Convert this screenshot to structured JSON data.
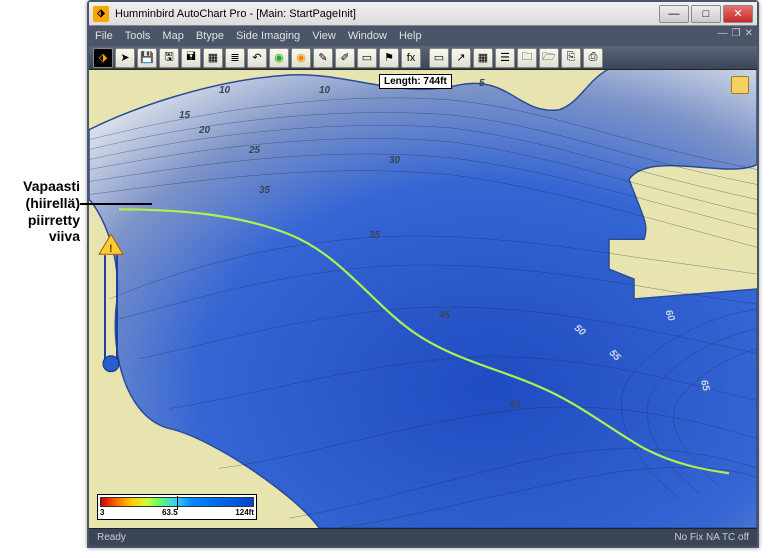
{
  "annotation": {
    "line1": "Vapaasti",
    "line2": "(hiirellä)",
    "line3": "piirretty",
    "line4": "viiva"
  },
  "window": {
    "title": "Humminbird AutoChart Pro - [Main: StartPageInit]"
  },
  "menu": {
    "file": "File",
    "tools": "Tools",
    "map": "Map",
    "btype": "Btype",
    "side_imaging": "Side Imaging",
    "view": "View",
    "window": "Window",
    "help": "Help"
  },
  "toolbar": {
    "icons": [
      "home-icon",
      "arrow-icon",
      "disk-icon",
      "save-icon",
      "saveas-icon",
      "table-icon",
      "list-icon",
      "undo-icon",
      "flag-green-icon",
      "flag-orange-icon",
      "tool-icon",
      "tool2-icon",
      "pointer-icon",
      "flag-icon",
      "fx-icon",
      "sep",
      "page-icon",
      "arrow2-icon",
      "grid-icon",
      "stack-icon",
      "folder-icon",
      "folder2-icon",
      "copy-icon",
      "print-icon"
    ]
  },
  "map": {
    "length_label": "Length: 744ft",
    "depth_labels": [
      "5",
      "10",
      "10",
      "15",
      "20",
      "25",
      "30",
      "35",
      "35",
      "40",
      "45",
      "50",
      "55",
      "60",
      "65"
    ]
  },
  "legend": {
    "min": "3",
    "mid": "63.5",
    "max": "124ft"
  },
  "status": {
    "left": "Ready",
    "right": "No Fix   NA  TC off"
  },
  "colors": {
    "land": "#e8e4b0",
    "shallow": "#cdd6e6",
    "deep": "#2b5cce",
    "track": "#b0f050"
  }
}
